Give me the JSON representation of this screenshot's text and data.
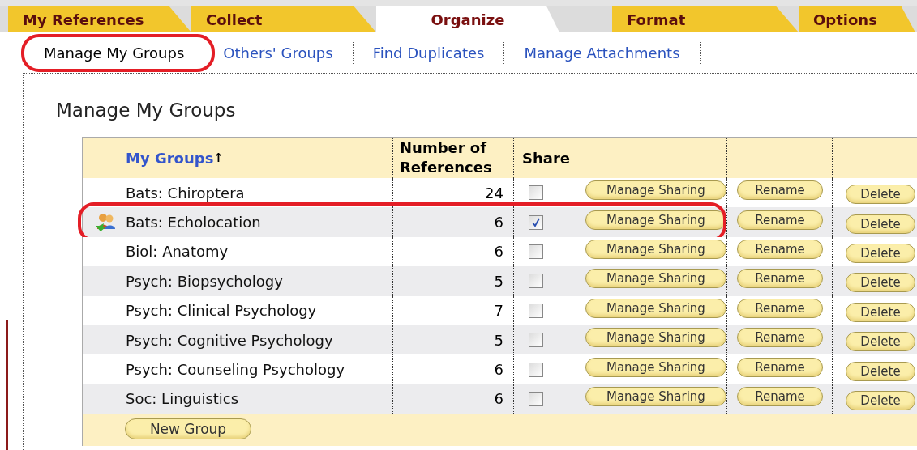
{
  "tabs": [
    {
      "label": "My References",
      "selected": false
    },
    {
      "label": "Collect",
      "selected": false
    },
    {
      "label": "Organize",
      "selected": true
    },
    {
      "label": "Format",
      "selected": false
    },
    {
      "label": "Options",
      "selected": false
    }
  ],
  "subtabs": [
    {
      "label": "Manage My Groups",
      "selected": true,
      "highlighted": true
    },
    {
      "label": "Others' Groups",
      "selected": false,
      "highlighted": false
    },
    {
      "label": "Find Duplicates",
      "selected": false,
      "highlighted": false
    },
    {
      "label": "Manage Attachments",
      "selected": false,
      "highlighted": false
    }
  ],
  "heading": "Manage My Groups",
  "table": {
    "columns": [
      "My Groups",
      "Number of References",
      "Share"
    ],
    "sort_indicator": "↑",
    "rows": [
      {
        "name": "Bats: Chiroptera",
        "count": "24",
        "shared": false,
        "highlighted": false,
        "actions": [
          "Manage Sharing",
          "Rename",
          "Delete"
        ]
      },
      {
        "name": "Bats: Echolocation",
        "count": "6",
        "shared": true,
        "highlighted": true,
        "actions": [
          "Manage Sharing",
          "Rename",
          "Delete"
        ]
      },
      {
        "name": "Biol: Anatomy",
        "count": "6",
        "shared": false,
        "highlighted": false,
        "actions": [
          "Manage Sharing",
          "Rename",
          "Delete"
        ]
      },
      {
        "name": "Psych: Biopsychology",
        "count": "5",
        "shared": false,
        "highlighted": false,
        "actions": [
          "Manage Sharing",
          "Rename",
          "Delete"
        ]
      },
      {
        "name": "Psych: Clinical Psychology",
        "count": "7",
        "shared": false,
        "highlighted": false,
        "actions": [
          "Manage Sharing",
          "Rename",
          "Delete"
        ]
      },
      {
        "name": "Psych: Cognitive Psychology",
        "count": "5",
        "shared": false,
        "highlighted": false,
        "actions": [
          "Manage Sharing",
          "Rename",
          "Delete"
        ]
      },
      {
        "name": "Psych: Counseling Psychology",
        "count": "6",
        "shared": false,
        "highlighted": false,
        "actions": [
          "Manage Sharing",
          "Rename",
          "Delete"
        ]
      },
      {
        "name": "Soc: Linguistics",
        "count": "6",
        "shared": false,
        "highlighted": false,
        "actions": [
          "Manage Sharing",
          "Rename",
          "Delete"
        ]
      }
    ],
    "footer_button": "New Group"
  }
}
